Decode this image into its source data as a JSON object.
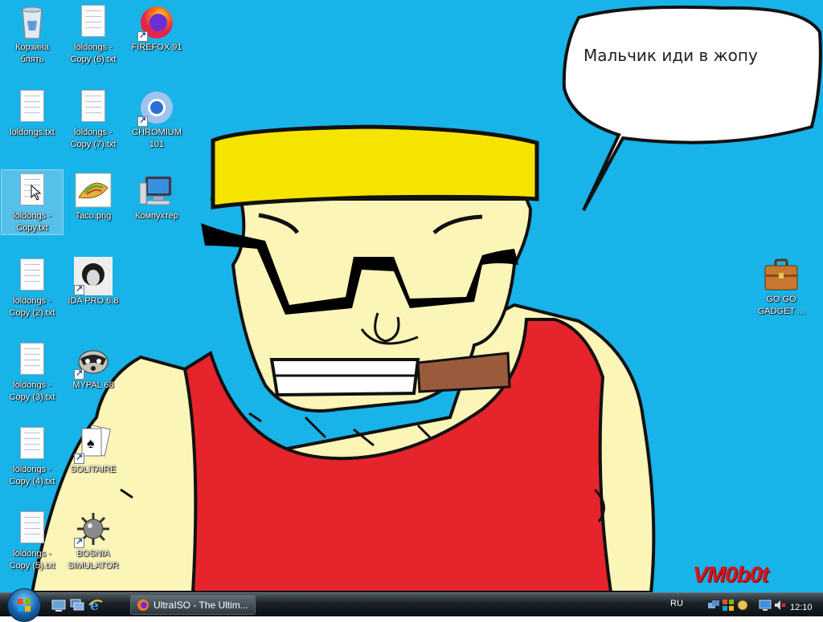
{
  "desktop": {
    "icons": [
      {
        "label": "Корзина блять"
      },
      {
        "label": "loldongs - Copy (6).txt"
      },
      {
        "label": "FIREFOX 91"
      },
      {
        "label": "loldongs.txt"
      },
      {
        "label": "loldongs - Copy (7).txt"
      },
      {
        "label": "CHROMIUM 101"
      },
      {
        "label": "loldongs - Copy.txt"
      },
      {
        "label": "Taco.png"
      },
      {
        "label": "Компухтер"
      },
      {
        "label": "loldongs - Copy (2).txt"
      },
      {
        "label": "IDA PRO 6.8"
      },
      {
        "label": "loldongs - Copy (3).txt"
      },
      {
        "label": "MYPAL 68"
      },
      {
        "label": "loldongs - Copy (4).txt"
      },
      {
        "label": "SOLITAIRE"
      },
      {
        "label": "loldongs - Copy (5).txt"
      },
      {
        "label": "BOSNIA SIMULATOR"
      },
      {
        "label": "GO GO GADGET ..."
      }
    ],
    "wallpaper": {
      "speech_bubble": "Мальчик иди в жопу",
      "watermark": "VM0b0t",
      "colors": {
        "sky": "#18b3e8",
        "hat": "#f5e300",
        "skin": "#fcf5b8",
        "shirt": "#e5242b",
        "cigar": "#9a5a3c"
      }
    }
  },
  "taskbar": {
    "start_icon": "windows-orb-icon",
    "quicklaunch": [
      "show-desktop-icon",
      "switch-windows-icon",
      "internet-explorer-icon"
    ],
    "task_button": "UltraISO - The Ultim...",
    "language": "RU",
    "clock": "12:10"
  }
}
